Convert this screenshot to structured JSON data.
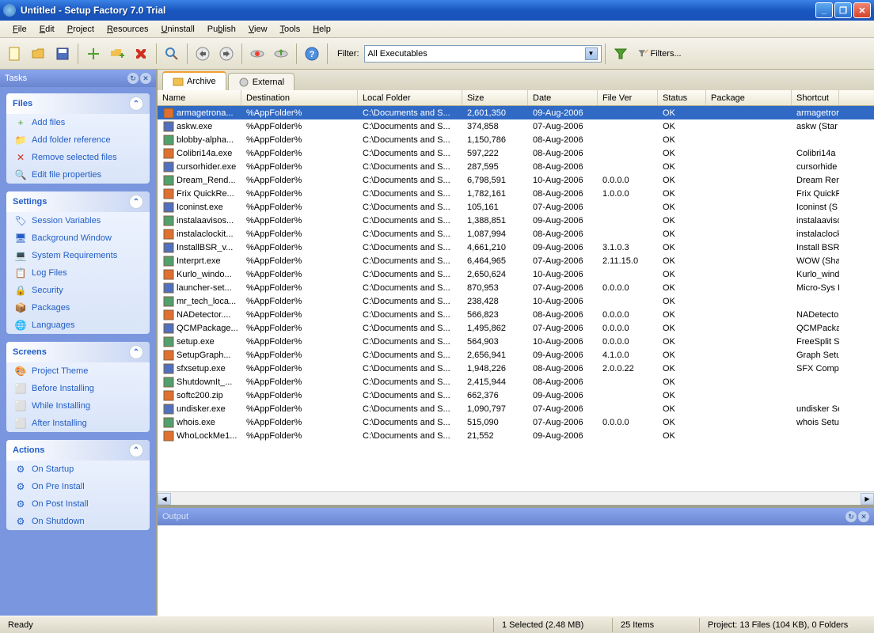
{
  "title": "Untitled - Setup Factory 7.0 Trial",
  "menu": [
    "File",
    "Edit",
    "Project",
    "Resources",
    "Uninstall",
    "Publish",
    "View",
    "Tools",
    "Help"
  ],
  "filter": {
    "label": "Filter:",
    "selected": "All Executables",
    "btn": "Filters..."
  },
  "tasks_header": "Tasks",
  "groups": {
    "files": {
      "title": "Files",
      "links": [
        "Add files",
        "Add folder reference",
        "Remove selected files",
        "Edit file properties"
      ]
    },
    "settings": {
      "title": "Settings",
      "links": [
        "Session Variables",
        "Background Window",
        "System Requirements",
        "Log Files",
        "Security",
        "Packages",
        "Languages"
      ]
    },
    "screens": {
      "title": "Screens",
      "links": [
        "Project Theme",
        "Before Installing",
        "While Installing",
        "After Installing"
      ]
    },
    "actions": {
      "title": "Actions",
      "links": [
        "On Startup",
        "On Pre Install",
        "On Post Install",
        "On Shutdown"
      ]
    }
  },
  "tabs": {
    "archive": "Archive",
    "external": "External"
  },
  "columns": [
    "Name",
    "Destination",
    "Local Folder",
    "Size",
    "Date",
    "File Ver",
    "Status",
    "Package",
    "Shortcut"
  ],
  "files": [
    {
      "n": "armagetrona...",
      "d": "%AppFolder%",
      "l": "C:\\Documents and S...",
      "s": "2,601,350",
      "dt": "09-Aug-2006",
      "v": "",
      "st": "OK",
      "p": "",
      "sc": "armagetron",
      "sel": true
    },
    {
      "n": "askw.exe",
      "d": "%AppFolder%",
      "l": "C:\\Documents and S...",
      "s": "374,858",
      "dt": "07-Aug-2006",
      "v": "",
      "st": "OK",
      "p": "",
      "sc": "askw (Star"
    },
    {
      "n": "blobby-alpha...",
      "d": "%AppFolder%",
      "l": "C:\\Documents and S...",
      "s": "1,150,786",
      "dt": "08-Aug-2006",
      "v": "",
      "st": "OK",
      "p": "",
      "sc": ""
    },
    {
      "n": "Colibri14a.exe",
      "d": "%AppFolder%",
      "l": "C:\\Documents and S...",
      "s": "597,222",
      "dt": "08-Aug-2006",
      "v": "",
      "st": "OK",
      "p": "",
      "sc": "Colibri14a"
    },
    {
      "n": "cursorhider.exe",
      "d": "%AppFolder%",
      "l": "C:\\Documents and S...",
      "s": "287,595",
      "dt": "08-Aug-2006",
      "v": "",
      "st": "OK",
      "p": "",
      "sc": "cursorhide"
    },
    {
      "n": "Dream_Rend...",
      "d": "%AppFolder%",
      "l": "C:\\Documents and S...",
      "s": "6,798,591",
      "dt": "10-Aug-2006",
      "v": "0.0.0.0",
      "st": "OK",
      "p": "",
      "sc": "Dream Ren"
    },
    {
      "n": "Frix QuickRe...",
      "d": "%AppFolder%",
      "l": "C:\\Documents and S...",
      "s": "1,782,161",
      "dt": "08-Aug-2006",
      "v": "1.0.0.0",
      "st": "OK",
      "p": "",
      "sc": "Frix QuickR"
    },
    {
      "n": "Iconinst.exe",
      "d": "%AppFolder%",
      "l": "C:\\Documents and S...",
      "s": "105,161",
      "dt": "07-Aug-2006",
      "v": "",
      "st": "OK",
      "p": "",
      "sc": "Iconinst (S"
    },
    {
      "n": "instalaavisos...",
      "d": "%AppFolder%",
      "l": "C:\\Documents and S...",
      "s": "1,388,851",
      "dt": "09-Aug-2006",
      "v": "",
      "st": "OK",
      "p": "",
      "sc": "instalaaviso"
    },
    {
      "n": "instalaclockit...",
      "d": "%AppFolder%",
      "l": "C:\\Documents and S...",
      "s": "1,087,994",
      "dt": "08-Aug-2006",
      "v": "",
      "st": "OK",
      "p": "",
      "sc": "instalaclock"
    },
    {
      "n": "InstallBSR_v...",
      "d": "%AppFolder%",
      "l": "C:\\Documents and S...",
      "s": "4,661,210",
      "dt": "09-Aug-2006",
      "v": "3.1.0.3",
      "st": "OK",
      "p": "",
      "sc": "Install BSR"
    },
    {
      "n": "Interprt.exe",
      "d": "%AppFolder%",
      "l": "C:\\Documents and S...",
      "s": "6,464,965",
      "dt": "07-Aug-2006",
      "v": "2.11.15.0",
      "st": "OK",
      "p": "",
      "sc": "WOW (Sha"
    },
    {
      "n": "Kurlo_windo...",
      "d": "%AppFolder%",
      "l": "C:\\Documents and S...",
      "s": "2,650,624",
      "dt": "10-Aug-2006",
      "v": "",
      "st": "OK",
      "p": "",
      "sc": "Kurlo_wind"
    },
    {
      "n": "launcher-set...",
      "d": "%AppFolder%",
      "l": "C:\\Documents and S...",
      "s": "870,953",
      "dt": "07-Aug-2006",
      "v": "0.0.0.0",
      "st": "OK",
      "p": "",
      "sc": "Micro-Sys L"
    },
    {
      "n": "mr_tech_loca...",
      "d": "%AppFolder%",
      "l": "C:\\Documents and S...",
      "s": "238,428",
      "dt": "10-Aug-2006",
      "v": "",
      "st": "OK",
      "p": "",
      "sc": ""
    },
    {
      "n": "NADetector....",
      "d": "%AppFolder%",
      "l": "C:\\Documents and S...",
      "s": "566,823",
      "dt": "08-Aug-2006",
      "v": "0.0.0.0",
      "st": "OK",
      "p": "",
      "sc": "NADetecto"
    },
    {
      "n": "QCMPackage...",
      "d": "%AppFolder%",
      "l": "C:\\Documents and S...",
      "s": "1,495,862",
      "dt": "07-Aug-2006",
      "v": "0.0.0.0",
      "st": "OK",
      "p": "",
      "sc": "QCMPacka"
    },
    {
      "n": "setup.exe",
      "d": "%AppFolder%",
      "l": "C:\\Documents and S...",
      "s": "564,903",
      "dt": "10-Aug-2006",
      "v": "0.0.0.0",
      "st": "OK",
      "p": "",
      "sc": "FreeSplit S"
    },
    {
      "n": "SetupGraph...",
      "d": "%AppFolder%",
      "l": "C:\\Documents and S...",
      "s": "2,656,941",
      "dt": "09-Aug-2006",
      "v": "4.1.0.0",
      "st": "OK",
      "p": "",
      "sc": "Graph Setu"
    },
    {
      "n": "sfxsetup.exe",
      "d": "%AppFolder%",
      "l": "C:\\Documents and S...",
      "s": "1,948,226",
      "dt": "08-Aug-2006",
      "v": "2.0.0.22",
      "st": "OK",
      "p": "",
      "sc": "SFX Compil"
    },
    {
      "n": "ShutdownIt_...",
      "d": "%AppFolder%",
      "l": "C:\\Documents and S...",
      "s": "2,415,944",
      "dt": "08-Aug-2006",
      "v": "",
      "st": "OK",
      "p": "",
      "sc": ""
    },
    {
      "n": "softc200.zip",
      "d": "%AppFolder%",
      "l": "C:\\Documents and S...",
      "s": "662,376",
      "dt": "09-Aug-2006",
      "v": "",
      "st": "OK",
      "p": "",
      "sc": ""
    },
    {
      "n": "undisker.exe",
      "d": "%AppFolder%",
      "l": "C:\\Documents and S...",
      "s": "1,090,797",
      "dt": "07-Aug-2006",
      "v": "",
      "st": "OK",
      "p": "",
      "sc": "undisker Se"
    },
    {
      "n": "whois.exe",
      "d": "%AppFolder%",
      "l": "C:\\Documents and S...",
      "s": "515,090",
      "dt": "07-Aug-2006",
      "v": "0.0.0.0",
      "st": "OK",
      "p": "",
      "sc": "whois Setu"
    },
    {
      "n": "WhoLockMe1...",
      "d": "%AppFolder%",
      "l": "C:\\Documents and S...",
      "s": "21,552",
      "dt": "09-Aug-2006",
      "v": "",
      "st": "OK",
      "p": "",
      "sc": ""
    }
  ],
  "output": "Output",
  "status": {
    "ready": "Ready",
    "selected": "1 Selected (2.48 MB)",
    "items": "25 Items",
    "project": "Project: 13 Files (104 KB), 0 Folders"
  }
}
